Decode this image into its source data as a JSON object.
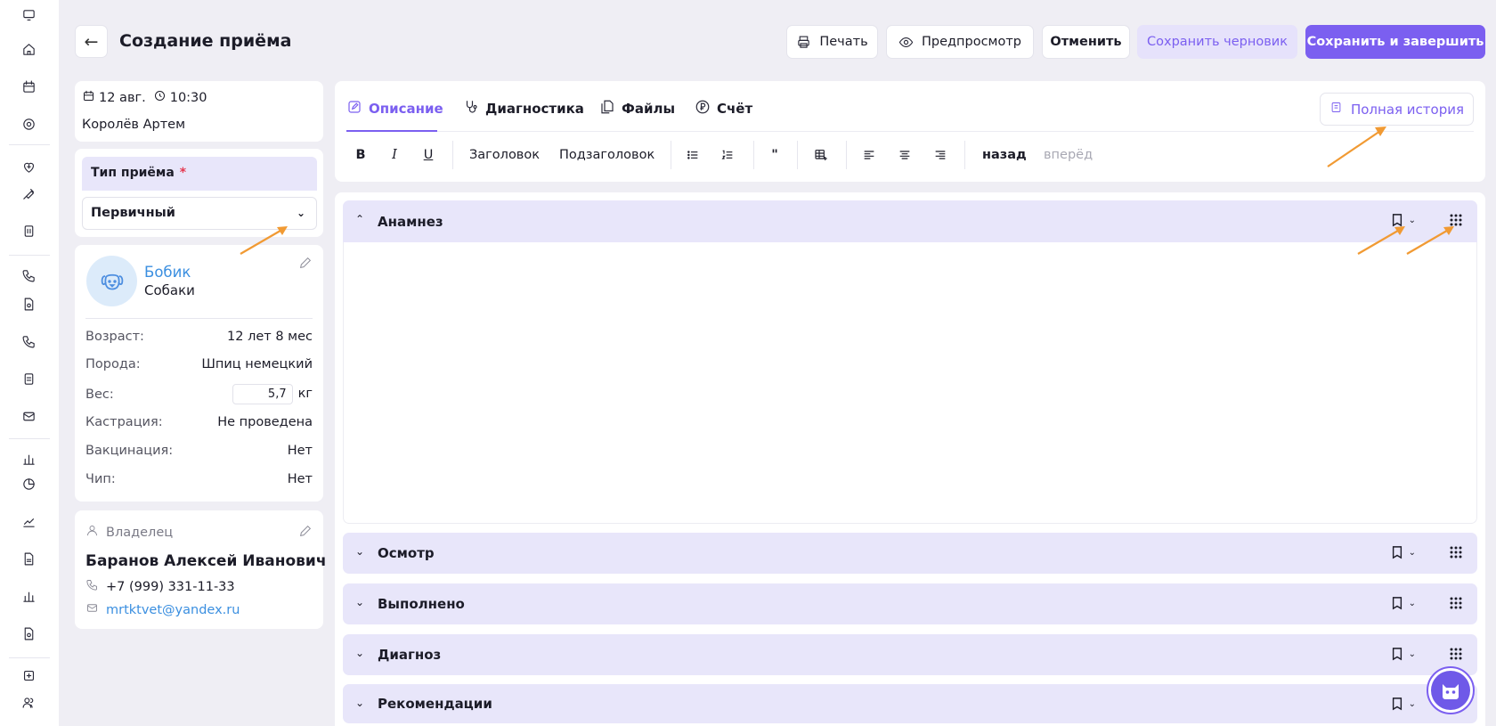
{
  "header": {
    "title": "Создание приёма",
    "buttons": {
      "print": "Печать",
      "preview": "Предпросмотр",
      "cancel": "Отменить",
      "save_draft": "Сохранить черновик",
      "save_finish": "Сохранить и завершить"
    }
  },
  "visit": {
    "date": "12 авг.",
    "time": "10:30",
    "doctor": "Королёв Артем"
  },
  "visit_type": {
    "label": "Тип приёма",
    "required_mark": "*",
    "value": "Первичный"
  },
  "pet": {
    "name": "Бобик",
    "species": "Собаки",
    "fields": [
      {
        "label": "Возраст:",
        "value": "12 лет 8 мес"
      },
      {
        "label": "Порода:",
        "value": "Шпиц немецкий"
      },
      {
        "label": "Вес:",
        "value": "5,7",
        "unit": "кг"
      },
      {
        "label": "Кастрация:",
        "value": "Не проведена"
      },
      {
        "label": "Вакцинация:",
        "value": "Нет"
      },
      {
        "label": "Чип:",
        "value": "Нет"
      }
    ]
  },
  "owner": {
    "heading": "Владелец",
    "name": "Баранов Алексей Иванович",
    "phone": "+7 (999) 331-11-33",
    "email": "mrtktvet@yandex.ru"
  },
  "editor": {
    "tabs": [
      "Описание",
      "Диагностика",
      "Файлы",
      "Счёт"
    ],
    "history_button": "Полная история",
    "toolbar": {
      "bold": "B",
      "italic": "I",
      "underline": "U",
      "heading": "Заголовок",
      "subheading": "Подзаголовок",
      "quote": "\"",
      "undo": "назад",
      "redo": "вперёд"
    }
  },
  "sections": [
    "Анамнез",
    "Осмотр",
    "Выполнено",
    "Диагноз",
    "Рекомендации"
  ],
  "colors": {
    "accent": "#7b5ff0",
    "accent_light": "#e8e6fa",
    "link": "#3b8fe0",
    "annotation_arrow": "#f19a33"
  }
}
